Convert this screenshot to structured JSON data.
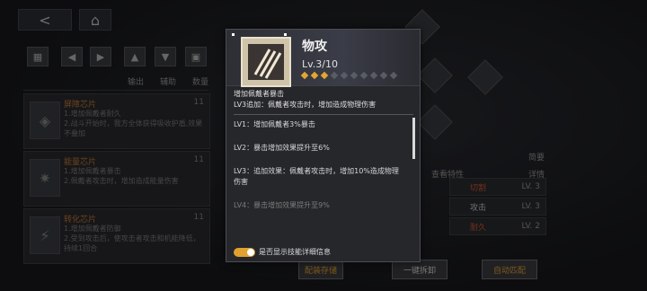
{
  "nav": {
    "back_icon": "<",
    "home_icon": "⌂"
  },
  "filters": {
    "items": [
      "输出",
      "辅助",
      "数量"
    ]
  },
  "chips": [
    {
      "title": "屏障芯片",
      "count": "11",
      "desc": "1.增加佩戴者耐久\n2.战斗开始时，我方全体获得吸收护盾,效果不叠加"
    },
    {
      "title": "能量芯片",
      "count": "11",
      "desc": "1.增加佩戴者暴击\n2.佩戴者攻击时，增加造成能量伤害"
    },
    {
      "title": "转化芯片",
      "count": "11",
      "desc": "1.增加佩戴者防御\n2.受到攻击后，使攻击者攻击和机能降低，持续1回合"
    }
  ],
  "right_panel": {
    "summary_label": "简要",
    "view_label": "查看特性",
    "detail_label": "详情",
    "rows": [
      {
        "name": "切割",
        "value": "LV. 3"
      },
      {
        "name": "攻击",
        "value": "LV. 3"
      },
      {
        "name": "耐久",
        "value": "LV. 2"
      }
    ]
  },
  "bottom": {
    "save_label": "配装存储",
    "dismantle_label": "一键拆卸",
    "auto_label": "自动匹配"
  },
  "popup": {
    "title": "物攻",
    "level": "Lv.3/10",
    "level_current": 3,
    "level_max": 10,
    "desc_line1": "增加佩戴者暴击",
    "desc_line2": "LV3追加：佩戴者攻击时，增加造成物理伤害",
    "levels": [
      "LV1：增加佩戴者3%暴击",
      "LV2：暴击增加效果提升至6%",
      "LV3：追加效果：佩戴者攻击时，增加10%造成物理伤害",
      "LV4：暴击增加效果提升至9%"
    ],
    "toggle_label": "是否显示技能详细信息",
    "toggle_on": true
  },
  "colors": {
    "accent": "#e5a432",
    "chip_title": "#c47a3a",
    "red_label": "#d35a34"
  }
}
